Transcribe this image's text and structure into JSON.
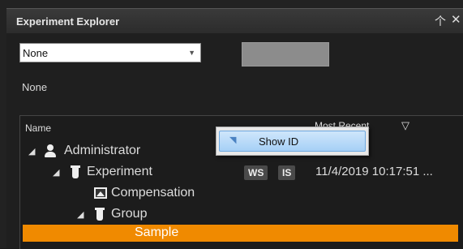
{
  "window": {
    "title": "Experiment Explorer"
  },
  "controls": {
    "dropdown_value": "None",
    "status_label": "None"
  },
  "tree": {
    "columns": {
      "name": "Name",
      "recent": "Most Recent"
    },
    "items": [
      {
        "label": "Administrator",
        "icon": "user-icon"
      },
      {
        "label": "Experiment",
        "icon": "tube-icon",
        "tags": [
          "WS",
          "IS"
        ],
        "timestamp": "11/4/2019 10:17:51 ..."
      },
      {
        "label": "Compensation",
        "icon": "image-icon"
      },
      {
        "label": "Group",
        "icon": "tube-icon"
      },
      {
        "label": "Sample",
        "selected": true
      }
    ]
  },
  "context_menu": {
    "items": [
      {
        "label": "Show ID"
      }
    ]
  },
  "colors": {
    "selection": "#f08a00",
    "menu_highlight": "#a6d0f6"
  }
}
